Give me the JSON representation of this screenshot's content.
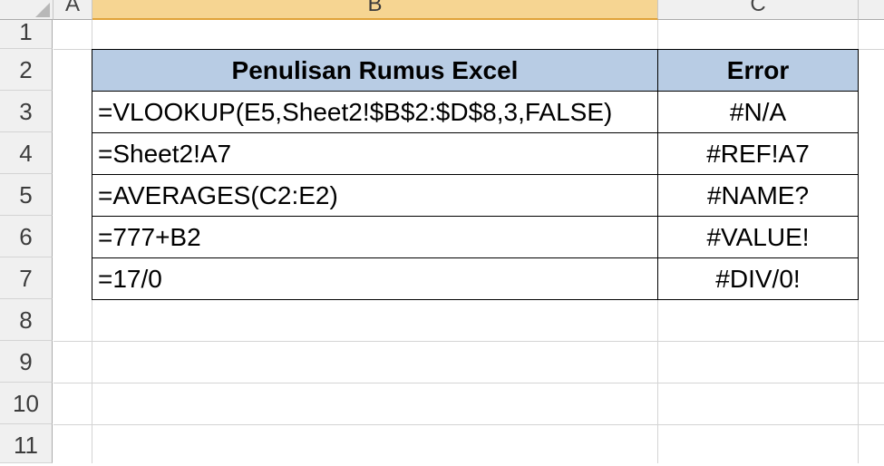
{
  "columns": [
    "A",
    "B",
    "C"
  ],
  "rows": [
    "1",
    "2",
    "3",
    "4",
    "5",
    "6",
    "7",
    "8",
    "9",
    "10",
    "11"
  ],
  "table": {
    "header": {
      "formula": "Penulisan Rumus Excel",
      "error": "Error"
    },
    "rows": [
      {
        "formula": "=VLOOKUP(E5,Sheet2!$B$2:$D$8,3,FALSE)",
        "error": "#N/A"
      },
      {
        "formula": "=Sheet2!A7",
        "error": "#REF!A7"
      },
      {
        "formula": "=AVERAGES(C2:E2)",
        "error": "#NAME?"
      },
      {
        "formula": "=777+B2",
        "error": "#VALUE!"
      },
      {
        "formula": "=17/0",
        "error": "#DIV/0!"
      }
    ]
  },
  "colors": {
    "header_fill": "#b8cce4",
    "selected_column": "#f6d592",
    "gridline": "#d4d4d4"
  }
}
